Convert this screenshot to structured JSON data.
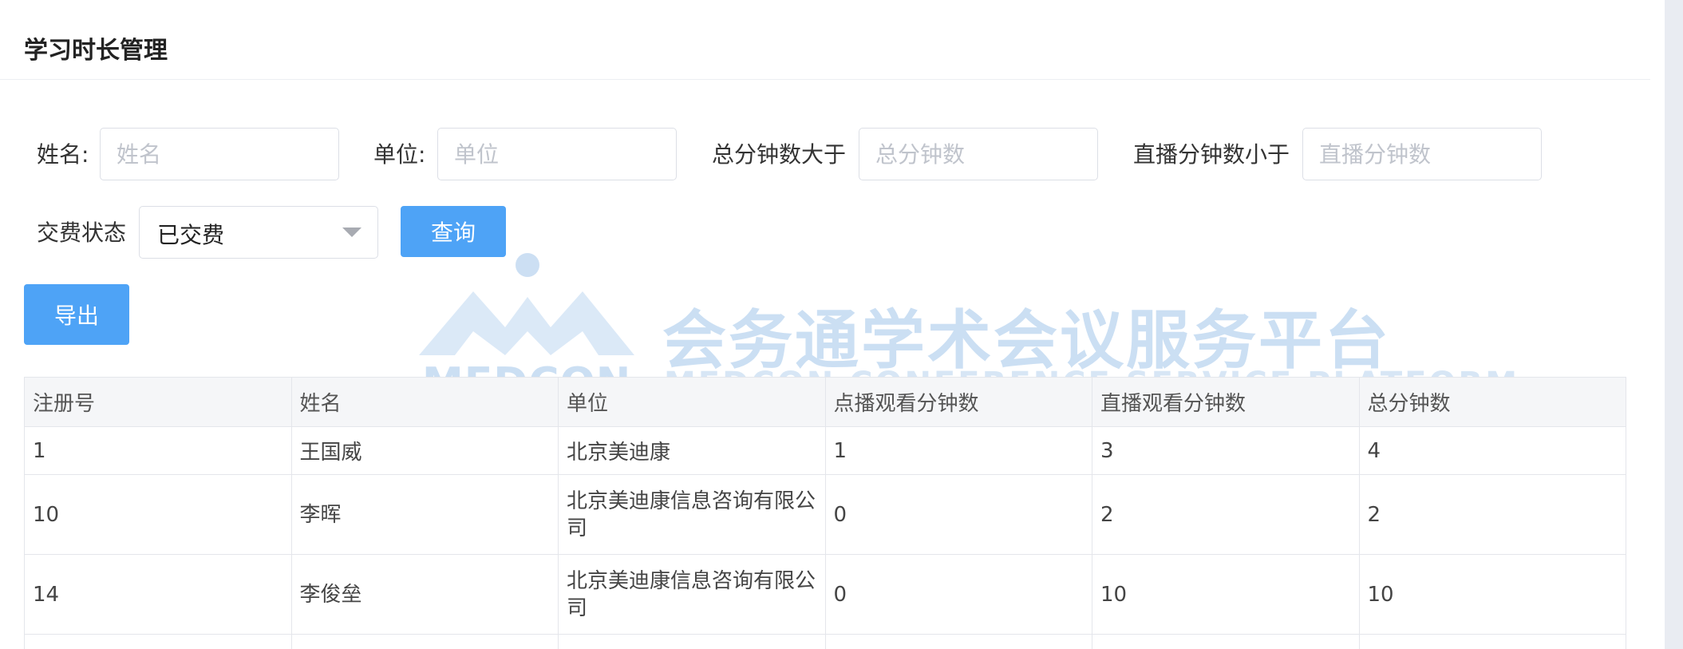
{
  "page": {
    "title": "学习时长管理"
  },
  "filters": {
    "name": {
      "label": "姓名:",
      "placeholder": "姓名",
      "value": ""
    },
    "unit": {
      "label": "单位:",
      "placeholder": "单位",
      "value": ""
    },
    "total_min": {
      "label": "总分钟数大于",
      "placeholder": "总分钟数",
      "value": ""
    },
    "live_min": {
      "label": "直播分钟数小于",
      "placeholder": "直播分钟数",
      "value": ""
    },
    "payment": {
      "label": "交费状态",
      "selected": "已交费"
    }
  },
  "buttons": {
    "query": "查询",
    "export": "导出"
  },
  "watermark": {
    "brand": "MEDCON",
    "title_cn": "会务通学术会议服务平台",
    "title_en": "MEDCON CONFERENCE SERVICE PLATFORM"
  },
  "table": {
    "columns": [
      "注册号",
      "姓名",
      "单位",
      "点播观看分钟数",
      "直播观看分钟数",
      "总分钟数"
    ],
    "rows": [
      {
        "id": "1",
        "name": "王国威",
        "unit": "北京美迪康",
        "vod": "1",
        "live": "3",
        "total": "4"
      },
      {
        "id": "10",
        "name": "李晖",
        "unit": "北京美迪康信息咨询有限公司",
        "vod": "0",
        "live": "2",
        "total": "2"
      },
      {
        "id": "14",
        "name": "李俊垒",
        "unit": "北京美迪康信息咨询有限公司",
        "vod": "0",
        "live": "10",
        "total": "10"
      }
    ]
  },
  "colors": {
    "primary": "#4ea3f6",
    "watermark": "#c6dcf2",
    "border": "#e4e6eb"
  }
}
